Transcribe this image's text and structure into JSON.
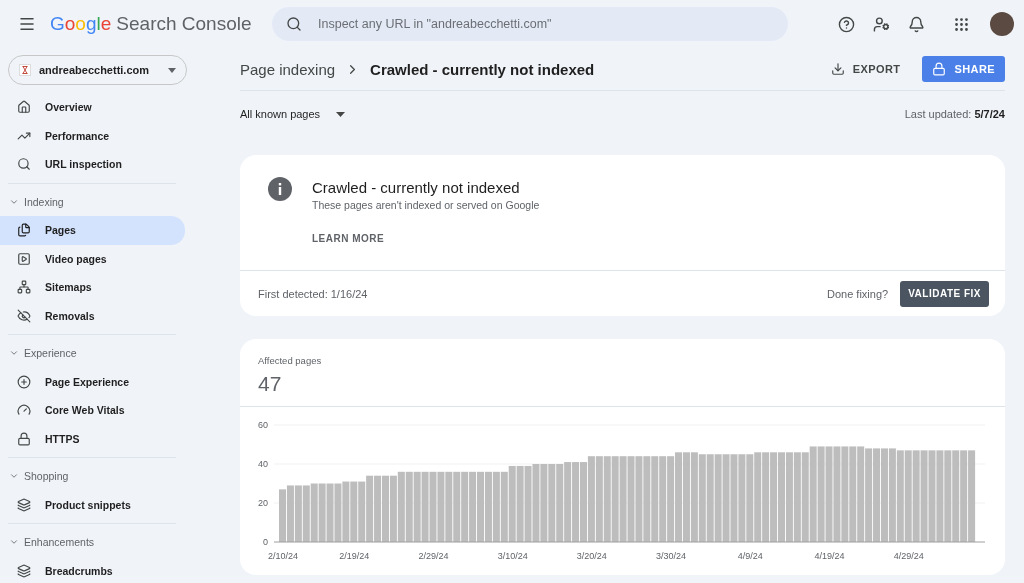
{
  "header": {
    "brand": "Google",
    "product": "Search Console",
    "search": {
      "placeholder": "Inspect any URL in \"andreabecchetti.com\""
    }
  },
  "property": {
    "name": "andreabecchetti.com"
  },
  "sidebar": {
    "top_items": [
      {
        "label": "Overview",
        "selected": false
      },
      {
        "label": "Performance",
        "selected": false
      },
      {
        "label": "URL inspection",
        "selected": false
      }
    ],
    "sections": [
      {
        "title": "Indexing",
        "expanded": true,
        "items": [
          {
            "label": "Pages",
            "selected": true
          },
          {
            "label": "Video pages",
            "selected": false
          },
          {
            "label": "Sitemaps",
            "selected": false
          },
          {
            "label": "Removals",
            "selected": false
          }
        ]
      },
      {
        "title": "Experience",
        "expanded": true,
        "items": [
          {
            "label": "Page Experience",
            "selected": false
          },
          {
            "label": "Core Web Vitals",
            "selected": false
          },
          {
            "label": "HTTPS",
            "selected": false
          }
        ]
      },
      {
        "title": "Shopping",
        "expanded": true,
        "items": [
          {
            "label": "Product snippets",
            "selected": false
          }
        ]
      },
      {
        "title": "Enhancements",
        "expanded": true,
        "items": [
          {
            "label": "Breadcrumbs",
            "selected": false
          }
        ]
      }
    ]
  },
  "page": {
    "breadcrumb": {
      "parent": "Page indexing",
      "current": "Crawled - currently not indexed"
    },
    "export": "EXPORT",
    "share": "SHARE",
    "filter": "All known pages",
    "last_updated_label": "Last updated:",
    "last_updated": "5/7/24"
  },
  "issue_card": {
    "title": "Crawled - currently not indexed",
    "description": "These pages aren't indexed or served on Google",
    "learn_more": "LEARN MORE",
    "first_detected": "First detected: 1/16/24",
    "done_fixing": "Done fixing?",
    "validate": "VALIDATE FIX"
  },
  "affected_card": {
    "label": "Affected pages",
    "count": "47",
    "chart_data": {
      "type": "bar",
      "categories": [
        "2/10/24",
        null,
        null,
        null,
        null,
        null,
        null,
        null,
        null,
        "2/19/24",
        null,
        null,
        null,
        null,
        null,
        null,
        null,
        null,
        null,
        "2/29/24",
        null,
        null,
        null,
        null,
        null,
        null,
        null,
        null,
        null,
        "3/10/24",
        null,
        null,
        null,
        null,
        null,
        null,
        null,
        null,
        null,
        "3/20/24",
        null,
        null,
        null,
        null,
        null,
        null,
        null,
        null,
        null,
        "3/30/24",
        null,
        null,
        null,
        null,
        null,
        null,
        null,
        null,
        null,
        "4/9/24",
        null,
        null,
        null,
        null,
        null,
        null,
        null,
        null,
        null,
        "4/19/24",
        null,
        null,
        null,
        null,
        null,
        null,
        null,
        null,
        null,
        "4/29/24",
        null,
        null,
        null,
        null,
        null,
        null,
        null,
        null
      ],
      "series": [
        {
          "color": "#bdbdbd",
          "values": [
            27,
            29,
            29,
            29,
            30,
            30,
            30,
            30,
            31,
            31,
            31,
            34,
            34,
            34,
            34,
            36,
            36,
            36,
            36,
            36,
            36,
            36,
            36,
            36,
            36,
            36,
            36,
            36,
            36,
            39,
            39,
            39,
            40,
            40,
            40,
            40,
            41,
            41,
            41,
            44,
            44,
            44,
            44,
            44,
            44,
            44,
            44,
            44,
            44,
            44,
            46,
            46,
            46,
            45,
            45,
            45,
            45,
            45,
            45,
            45,
            46,
            46,
            46,
            46,
            46,
            46,
            46,
            49,
            49,
            49,
            49,
            49,
            49,
            49,
            48,
            48,
            48,
            48,
            47,
            47,
            47,
            47,
            47,
            47,
            47,
            47,
            47,
            47
          ]
        }
      ],
      "ylim": [
        0,
        60
      ],
      "yticks": [
        0,
        20,
        40,
        60
      ]
    }
  }
}
